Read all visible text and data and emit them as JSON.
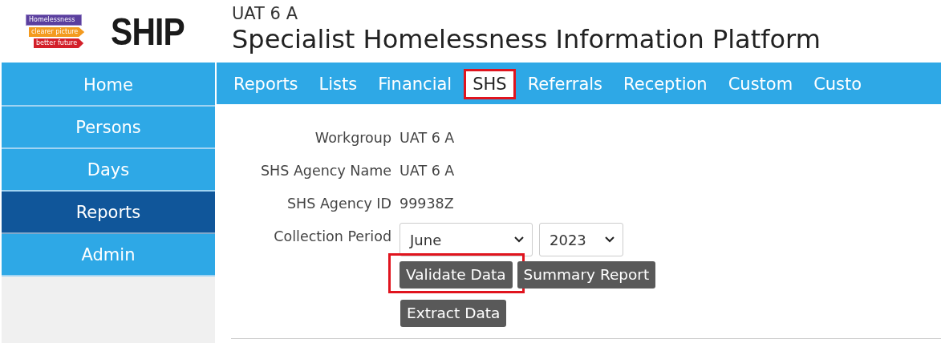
{
  "logo": {
    "name": "SHIP",
    "tags": [
      "Homelessness",
      "clearer picture",
      "better future"
    ]
  },
  "header": {
    "workgroup": "UAT 6 A",
    "title": "Specialist Homelessness Information Platform"
  },
  "sidebar": {
    "items": [
      {
        "label": "Home",
        "selected": false
      },
      {
        "label": "Persons",
        "selected": false
      },
      {
        "label": "Days",
        "selected": false
      },
      {
        "label": "Reports",
        "selected": true
      },
      {
        "label": "Admin",
        "selected": false
      }
    ]
  },
  "tabs": [
    {
      "label": "Reports",
      "selected": false,
      "highlighted": false
    },
    {
      "label": "Lists",
      "selected": false,
      "highlighted": false
    },
    {
      "label": "Financial",
      "selected": false,
      "highlighted": false
    },
    {
      "label": "SHS",
      "selected": true,
      "highlighted": true
    },
    {
      "label": "Referrals",
      "selected": false,
      "highlighted": false
    },
    {
      "label": "Reception",
      "selected": false,
      "highlighted": false
    },
    {
      "label": "Custom",
      "selected": false,
      "highlighted": false
    },
    {
      "label": "Custo",
      "selected": false,
      "highlighted": false
    }
  ],
  "form": {
    "fields": [
      {
        "label": "Workgroup",
        "value": "UAT 6 A"
      },
      {
        "label": "SHS Agency Name",
        "value": "UAT 6 A"
      },
      {
        "label": "SHS Agency ID",
        "value": "99938Z"
      }
    ],
    "collection_period": {
      "label": "Collection Period",
      "month": "June",
      "year": "2023"
    },
    "buttons": [
      {
        "label": "Validate Data",
        "highlighted": true
      },
      {
        "label": "Summary Report",
        "highlighted": false
      },
      {
        "label": "Extract Data",
        "highlighted": false
      }
    ]
  }
}
